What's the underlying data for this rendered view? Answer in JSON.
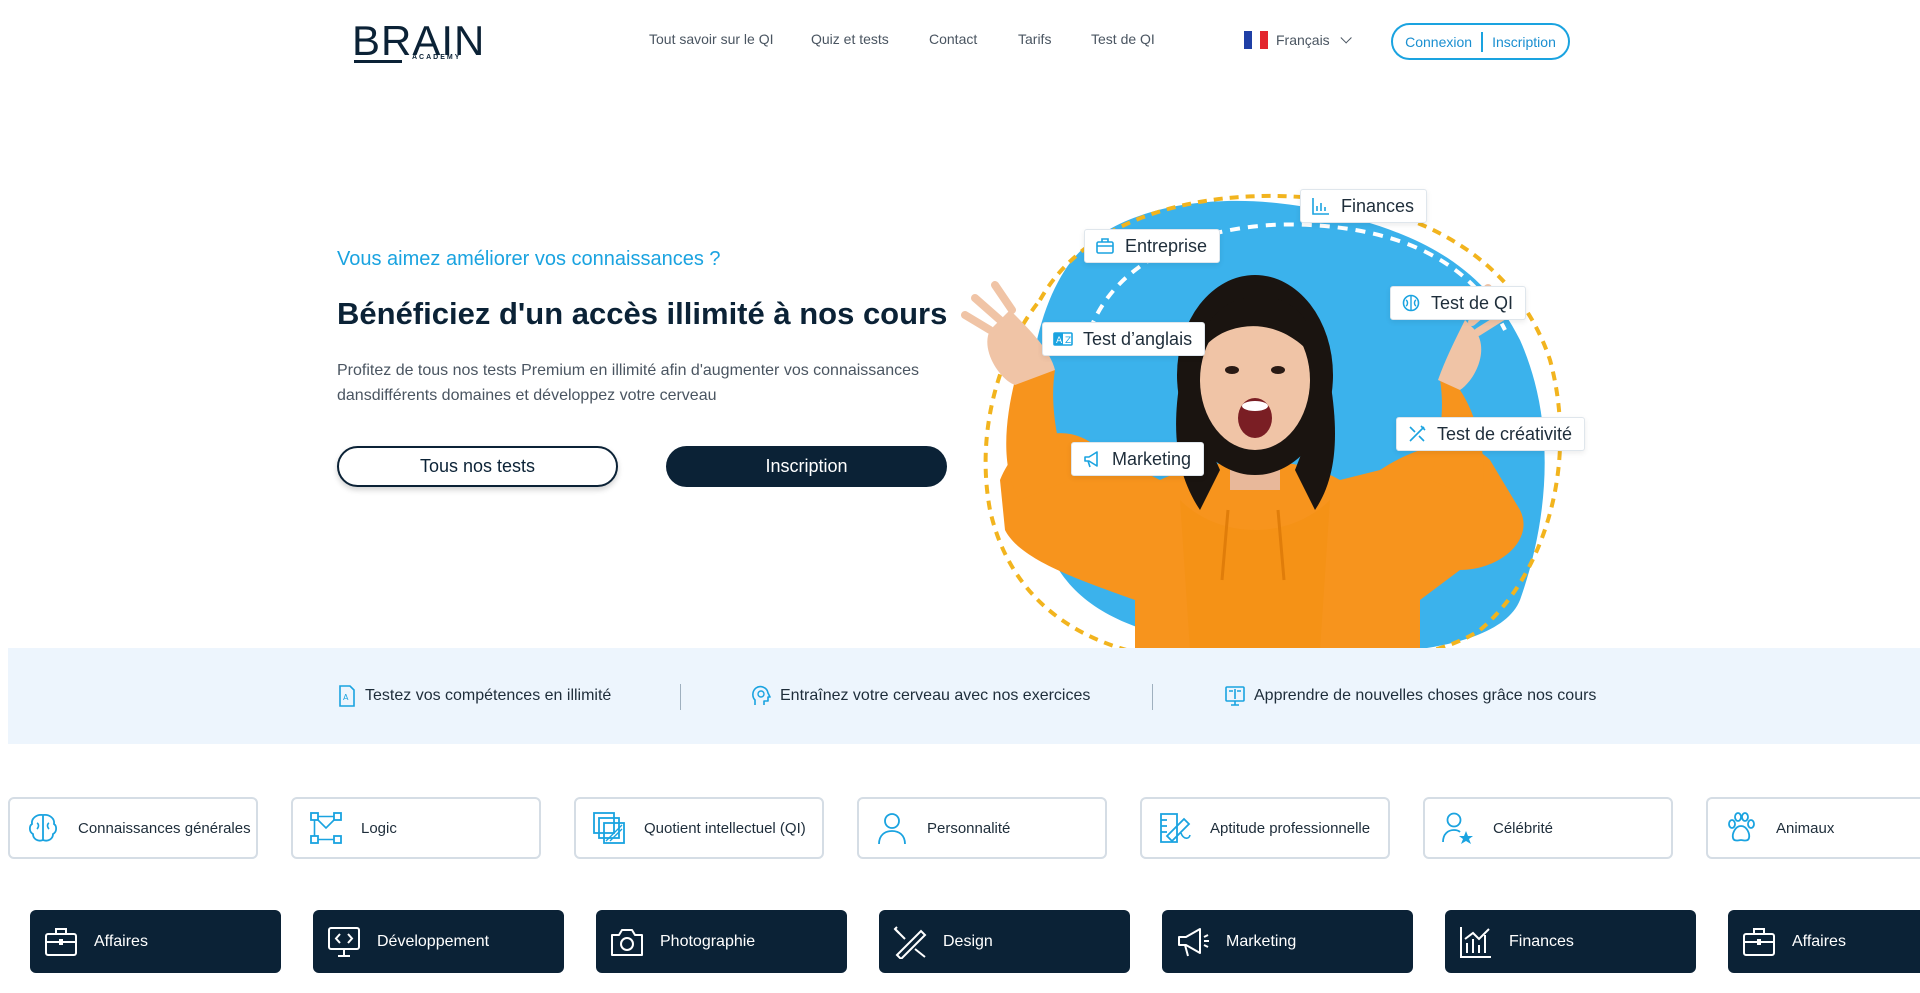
{
  "header": {
    "logo_word": "BRAIN",
    "logo_sub": "ACADEMY",
    "nav": [
      "Tout savoir sur le QI",
      "Quiz et tests",
      "Contact",
      "Tarifs",
      "Test de QI"
    ],
    "language": "Français",
    "login": "Connexion",
    "signup": "Inscription"
  },
  "hero": {
    "eyebrow": "Vous aimez améliorer vos connaissances ?",
    "title": "Bénéficiez d'un accès illimité à nos cours",
    "text": "Profitez de tous nos tests Premium en illimité afin d'augmenter vos connaissances dansdifférents domaines et développez votre cerveau",
    "btn_tests": "Tous nos tests",
    "btn_signup": "Inscription",
    "tags": {
      "finances": "Finances",
      "entreprise": "Entreprise",
      "test_qi": "Test de QI",
      "anglais": "Test d’anglais",
      "marketing": "Marketing",
      "creativite": "Test de créativité"
    }
  },
  "features": [
    "Testez vos compétences en illimité",
    "Entraînez votre cerveau avec nos exercices",
    "Apprendre de nouvelles choses grâce nos cours"
  ],
  "categories": [
    "Connaissances générales",
    "Logic",
    "Quotient intellectuel (QI)",
    "Personnalité",
    "Aptitude professionnelle",
    "Célébrité",
    "Animaux"
  ],
  "topics": [
    "Affaires",
    "Développement",
    "Photographie",
    "Design",
    "Marketing",
    "Finances",
    "Affaires"
  ],
  "colors": {
    "navy": "#0b2236",
    "accent_blue": "#1aa3e0",
    "blob_blue": "#3bb2ec",
    "dash_yellow": "#f2b41e",
    "hoodie_orange": "#f7941d",
    "band_bg": "#edf5fd"
  }
}
